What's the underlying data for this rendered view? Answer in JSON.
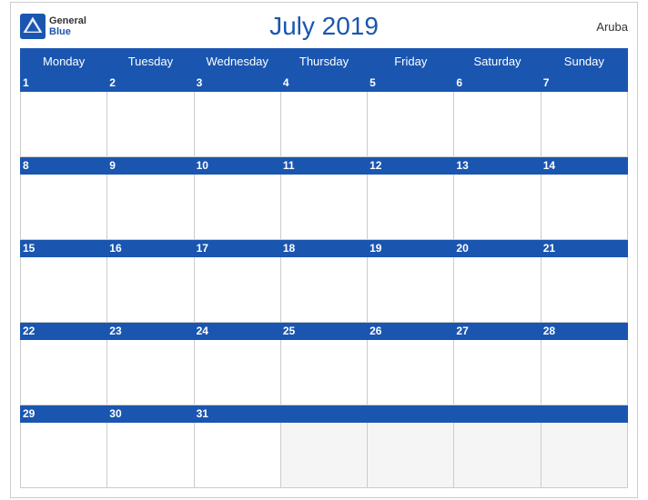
{
  "header": {
    "title": "July 2019",
    "country": "Aruba",
    "logo": {
      "general": "General",
      "blue": "Blue"
    }
  },
  "weekdays": [
    "Monday",
    "Tuesday",
    "Wednesday",
    "Thursday",
    "Friday",
    "Saturday",
    "Sunday"
  ],
  "weeks": [
    [
      {
        "day": 1,
        "empty": false
      },
      {
        "day": 2,
        "empty": false
      },
      {
        "day": 3,
        "empty": false
      },
      {
        "day": 4,
        "empty": false
      },
      {
        "day": 5,
        "empty": false
      },
      {
        "day": 6,
        "empty": false
      },
      {
        "day": 7,
        "empty": false
      }
    ],
    [
      {
        "day": 8,
        "empty": false
      },
      {
        "day": 9,
        "empty": false
      },
      {
        "day": 10,
        "empty": false
      },
      {
        "day": 11,
        "empty": false
      },
      {
        "day": 12,
        "empty": false
      },
      {
        "day": 13,
        "empty": false
      },
      {
        "day": 14,
        "empty": false
      }
    ],
    [
      {
        "day": 15,
        "empty": false
      },
      {
        "day": 16,
        "empty": false
      },
      {
        "day": 17,
        "empty": false
      },
      {
        "day": 18,
        "empty": false
      },
      {
        "day": 19,
        "empty": false
      },
      {
        "day": 20,
        "empty": false
      },
      {
        "day": 21,
        "empty": false
      }
    ],
    [
      {
        "day": 22,
        "empty": false
      },
      {
        "day": 23,
        "empty": false
      },
      {
        "day": 24,
        "empty": false
      },
      {
        "day": 25,
        "empty": false
      },
      {
        "day": 26,
        "empty": false
      },
      {
        "day": 27,
        "empty": false
      },
      {
        "day": 28,
        "empty": false
      }
    ],
    [
      {
        "day": 29,
        "empty": false
      },
      {
        "day": 30,
        "empty": false
      },
      {
        "day": 31,
        "empty": false
      },
      {
        "day": null,
        "empty": true
      },
      {
        "day": null,
        "empty": true
      },
      {
        "day": null,
        "empty": true
      },
      {
        "day": null,
        "empty": true
      }
    ]
  ],
  "colors": {
    "header_bg": "#1a56b0",
    "header_text": "#ffffff",
    "day_num": "#1a56b0",
    "border": "#cccccc"
  }
}
